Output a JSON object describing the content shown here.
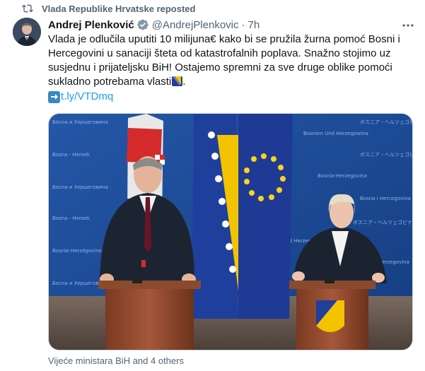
{
  "repost": {
    "text": "Vlada Republike Hrvatske reposted",
    "icon": "repost-icon"
  },
  "author": {
    "name": "Andrej Plenković",
    "handle": "@AndrejPlenkovic",
    "separator": "·",
    "time": "7h"
  },
  "tweet": {
    "text": "Vlada je odlučila uputiti 10 milijuna€ kako bi se pružila žurna pomoć Bosni i Hercegovini u sanaciji šteta od katastrofalnih poplava. Snažno stojimo uz susjednu i prijateljsku BiH! Ostajemo spremni za sve druge oblike pomoći sukladno potrebama vlasti",
    "link": "t.ly/VTDmq"
  },
  "media": {
    "backdrop_texts": [
      "Босна и Херцеговина",
      "Bosna i Hercegovina",
      "ボスニア・ヘルツェゴビナ",
      "Bosnien Und Herzegowina",
      "Bosna - Hersek",
      "Bosnie-Herzégovine",
      "Bosnia-Herzegovina"
    ]
  },
  "caption": {
    "text": "Vijeće ministara BiH and 4 others"
  },
  "colors": {
    "link": "#1d9bf0",
    "secondary": "#536471",
    "text": "#0f1419",
    "backdrop": "#1e4d9b"
  }
}
